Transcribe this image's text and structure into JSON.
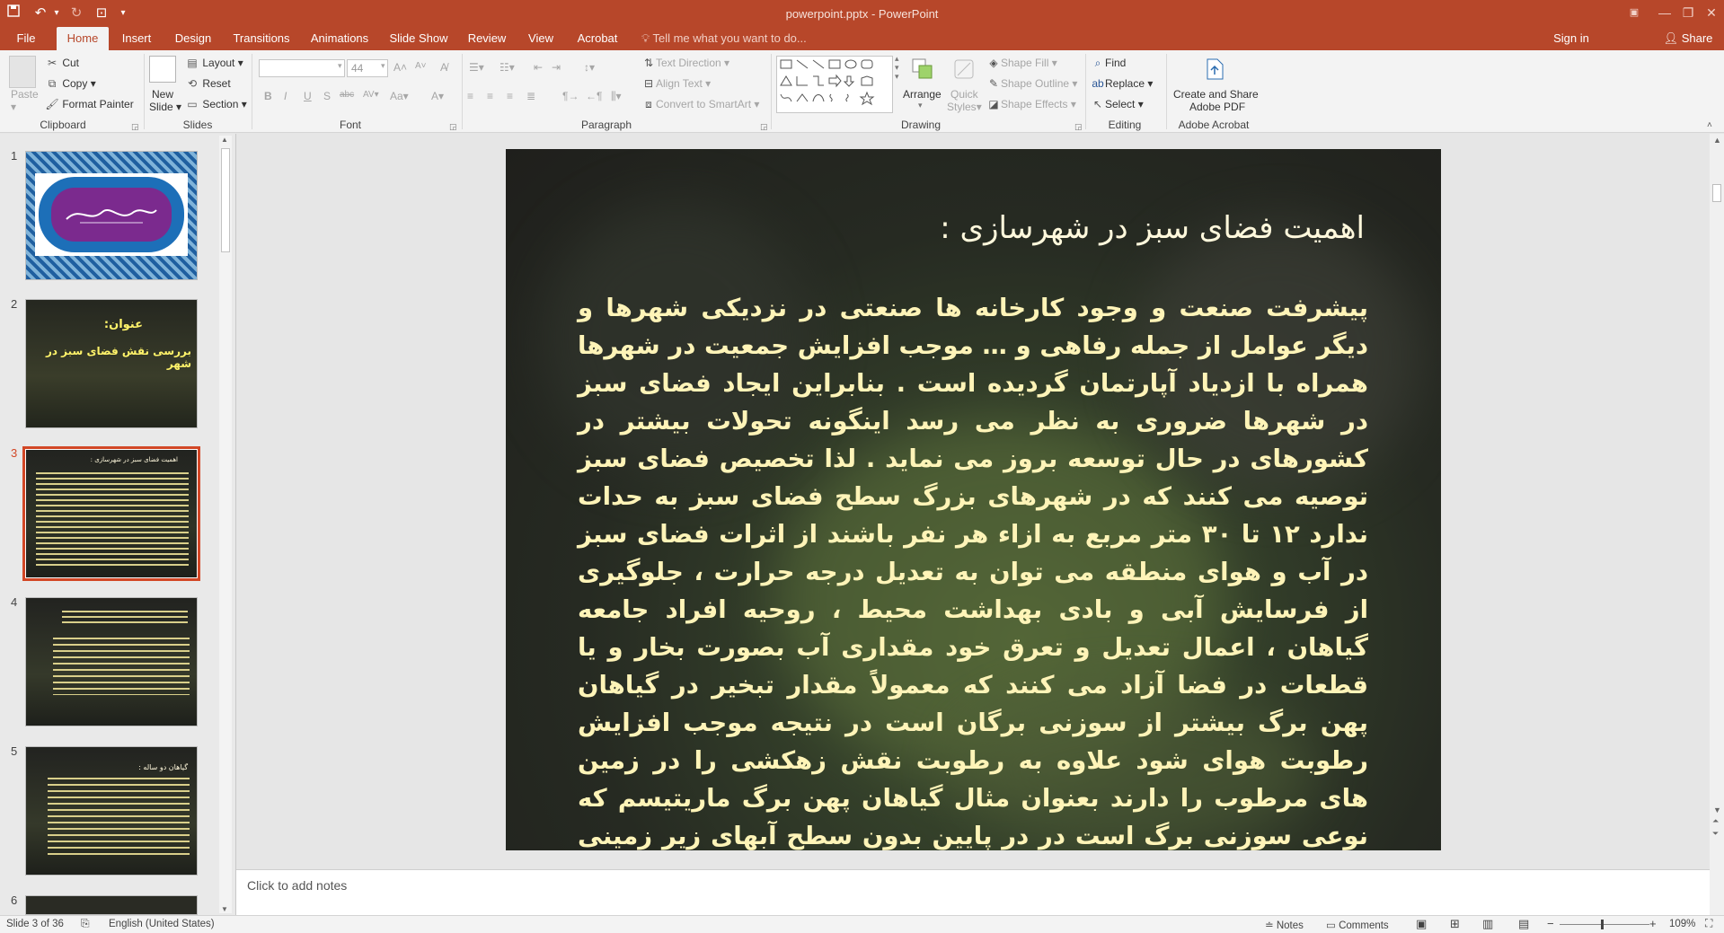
{
  "app": {
    "doc_title": "powerpoint.pptx - PowerPoint"
  },
  "quick_access": {
    "save_icon": "save-icon",
    "undo_icon": "undo-icon",
    "redo_icon": "redo-icon",
    "present_icon": "present-from-start-icon"
  },
  "tabs": [
    "File",
    "Home",
    "Insert",
    "Design",
    "Transitions",
    "Animations",
    "Slide Show",
    "Review",
    "View",
    "Acrobat"
  ],
  "active_tab": "Home",
  "tell_me": "Tell me what you want to do...",
  "sign_in": "Sign in",
  "share": "Share",
  "ribbon": {
    "clipboard": {
      "paste": "Paste",
      "cut": "Cut",
      "copy": "Copy",
      "format_painter": "Format Painter",
      "group": "Clipboard"
    },
    "slides": {
      "new_slide_1": "New",
      "new_slide_2": "Slide",
      "layout": "Layout",
      "reset": "Reset",
      "section": "Section",
      "group": "Slides"
    },
    "font": {
      "font_name": "",
      "font_size": "44",
      "group": "Font"
    },
    "paragraph": {
      "text_direction": "Text Direction",
      "align_text": "Align Text",
      "convert_smartart": "Convert to SmartArt",
      "group": "Paragraph"
    },
    "drawing": {
      "arrange": "Arrange",
      "quick_styles_1": "Quick",
      "quick_styles_2": "Styles",
      "shape_fill": "Shape Fill",
      "shape_outline": "Shape Outline",
      "shape_effects": "Shape Effects",
      "group": "Drawing"
    },
    "editing": {
      "find": "Find",
      "replace": "Replace",
      "select": "Select",
      "group": "Editing"
    },
    "acrobat": {
      "create_1": "Create and Share",
      "create_2": "Adobe PDF",
      "group": "Adobe Acrobat"
    }
  },
  "thumbnails": [
    {
      "num": "1"
    },
    {
      "num": "2",
      "line1": "عنوان:",
      "line2": "بررسی نقش فضای سبز در شهر"
    },
    {
      "num": "3",
      "title": "اهمیت فضای سبز در شهرسازی :"
    },
    {
      "num": "4"
    },
    {
      "num": "5",
      "title": "گیاهان دو ساله :"
    },
    {
      "num": "6"
    }
  ],
  "slide": {
    "title": "اهمیت فضای سبز در شهرسازی :",
    "body": "پیشرفت صنعت و وجود کارخانه ها صنعتی در نزدیکی شهرها و دیگر عوامل از جمله رفاهی و … موجب افزایش جمعیت در شهرها همراه با ازدیاد آپارتمان گردیده است . بنابراین ایجاد فضای سبز در شهرها ضروری به نظر می رسد اینگونه تحولات بیشتر در کشورهای در حال توسعه بروز می نماید . لذا تخصیص فضای سبز توصیه می کنند که در شهرهای بزرگ سطح فضای سبز به حدات ندارد ۱۲ تا ۳۰ متر مربع به ازاء هر نفر باشند از اثرات فضای سبز در آب و هوای منطقه می توان به تعدیل درجه حرارت ، جلوگیری از فرسایش آبی و بادی بهداشت محیط ، روحیه افراد جامعه گیاهان ، اعمال تعدیل و تعرق خود مقداری آب بصورت بخار و یا قطعات در فضا آزاد می کنند که معمولاً مقدار تبخیر در گیاهان پهن برگ بیشتر از سوزنی برگان است در نتیجه موجب افزایش رطوبت هوای شود علاوه به رطوبت نقش زهکشی را در زمین های مرطوب را دارند بعنوان مثال گیاهان پهن برگ ماریتیسم که نوعی سوزنی برگ است در در پایین بدون سطح آبهای زیر زمینی نقش دارد"
  },
  "notes_placeholder": "Click to add notes",
  "status": {
    "slide_info": "Slide 3 of 36",
    "language": "English (United States)",
    "notes": "Notes",
    "comments": "Comments",
    "zoom": "109%"
  },
  "colors": {
    "accent": "#b7472a",
    "selected_thumb": "#d24726",
    "body_text": "#fff4b8"
  }
}
